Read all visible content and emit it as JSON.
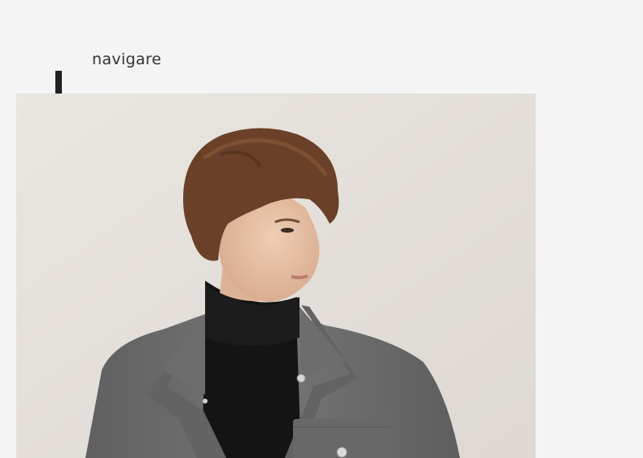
{
  "header": {
    "brand_text": "navigare"
  },
  "hero": {
    "image_description_icon": "model-photo",
    "colors": {
      "background": "#e6e2dd",
      "skin": "#e6c2a6",
      "hair": "#6a4028",
      "turtleneck": "#151515",
      "coat": "#6f706f",
      "coat_dark": "#5c5c5c",
      "buttons": "#d8d8d8"
    }
  }
}
